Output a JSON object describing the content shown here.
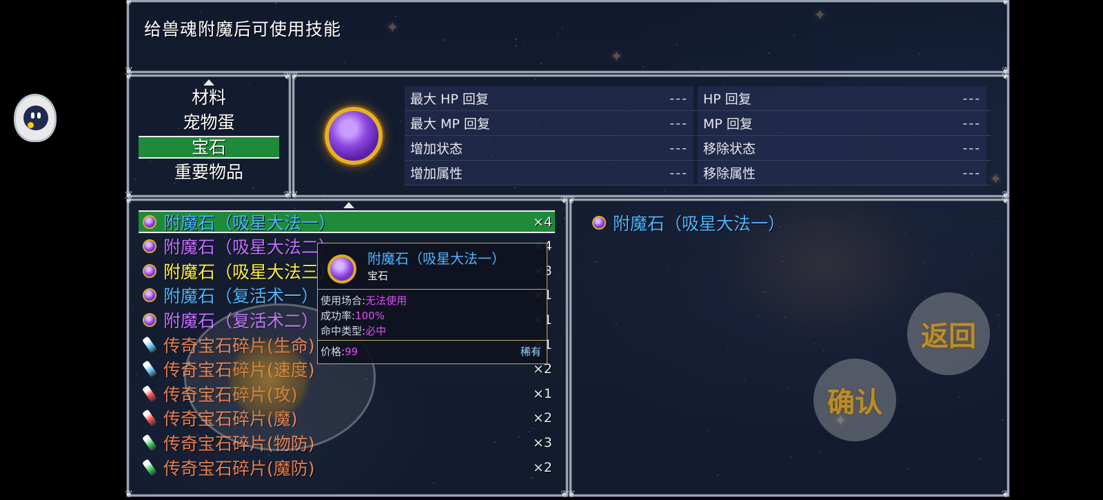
{
  "help": {
    "text": "给兽魂附魔后可使用技能"
  },
  "categories": [
    {
      "label": "材料",
      "selected": false
    },
    {
      "label": "宠物蛋",
      "selected": false
    },
    {
      "label": "宝石",
      "selected": true
    },
    {
      "label": "重要物品",
      "selected": false
    }
  ],
  "detail": {
    "icon": "purple-gem-icon",
    "rows": [
      [
        {
          "label": "最大 HP 回复",
          "value": "---"
        },
        {
          "label": "HP 回复",
          "value": "---"
        }
      ],
      [
        {
          "label": "最大 MP 回复",
          "value": "---"
        },
        {
          "label": "MP 回复",
          "value": "---"
        }
      ],
      [
        {
          "label": "增加状态",
          "value": "---"
        },
        {
          "label": "移除状态",
          "value": "---"
        }
      ],
      [
        {
          "label": "增加属性",
          "value": "---"
        },
        {
          "label": "移除属性",
          "value": "---"
        }
      ]
    ]
  },
  "items": [
    {
      "name": "附魔石（吸星大法一）",
      "qty": "×4",
      "color": "#4fb4ff",
      "icon": "orb",
      "selected": true
    },
    {
      "name": "附魔石（吸星大法二）",
      "qty": "×4",
      "color": "#c070ff",
      "icon": "orb"
    },
    {
      "name": "附魔石（吸星大法三）",
      "qty": "×3",
      "color": "#ffee44",
      "icon": "orb"
    },
    {
      "name": "附魔石（复活术一）",
      "qty": "×1",
      "color": "#4fb4ff",
      "icon": "orb"
    },
    {
      "name": "附魔石（复活术二）",
      "qty": "×1",
      "color": "#c070ff",
      "icon": "orb"
    },
    {
      "name": "传奇宝石碎片(生命)",
      "qty": "×1",
      "color": "#e88050",
      "icon": "shard",
      "shardColor": "#66c8ff"
    },
    {
      "name": "传奇宝石碎片(速度)",
      "qty": "×2",
      "color": "#e88050",
      "icon": "shard",
      "shardColor": "#66c8ff"
    },
    {
      "name": "传奇宝石碎片(攻)",
      "qty": "×1",
      "color": "#e88050",
      "icon": "shard",
      "shardColor": "#ff4a4a"
    },
    {
      "name": "传奇宝石碎片(魔)",
      "qty": "×2",
      "color": "#e88050",
      "icon": "shard",
      "shardColor": "#ff4a4a"
    },
    {
      "name": "传奇宝石碎片(物防)",
      "qty": "×3",
      "color": "#e88050",
      "icon": "shard",
      "shardColor": "#3fd060"
    },
    {
      "name": "传奇宝石碎片(魔防)",
      "qty": "×2",
      "color": "#e88050",
      "icon": "shard",
      "shardColor": "#3fd060"
    }
  ],
  "info": {
    "name": "附魔石（吸星大法一）"
  },
  "tooltip": {
    "name": "附魔石（吸星大法一）",
    "type": "宝石",
    "use_label": "使用场合:",
    "use_value": "无法使用",
    "rate_label": "成功率:",
    "rate_value": "100%",
    "hit_label": "命中类型:",
    "hit_value": "必中",
    "price_label": "价格:",
    "price_value": "99",
    "rarity": "稀有"
  },
  "buttons": {
    "back": "返回",
    "ok": "确认"
  },
  "colors": {
    "selected": "#1f8a3a",
    "frame": "#9aa3b2",
    "gem_gold": "#e3b227"
  }
}
